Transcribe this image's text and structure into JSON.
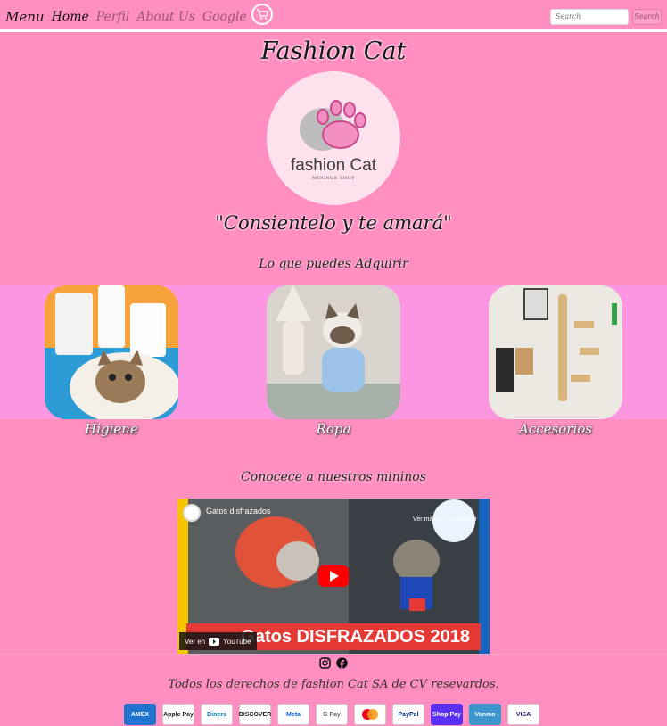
{
  "nav": {
    "brand": "Menu",
    "links": [
      {
        "label": "Home",
        "state": "active"
      },
      {
        "label": "Perfil",
        "state": "muted"
      },
      {
        "label": "About Us",
        "state": "muted"
      },
      {
        "label": "Google",
        "state": "muted"
      }
    ],
    "cart_icon": "shopping-cart-icon",
    "search": {
      "placeholder": "Search",
      "button_label": "Search"
    }
  },
  "hero": {
    "title": "Fashion Cat",
    "logo": {
      "text": "fashion Cat",
      "sub": "MININOS SHOP"
    },
    "tagline": "\"Consientelo y te amará\""
  },
  "products": {
    "heading": "Lo que puedes Adquirir",
    "items": [
      {
        "label": "Higiene"
      },
      {
        "label": "Ropa"
      },
      {
        "label": "Accesorios"
      }
    ]
  },
  "video_section": {
    "heading": "Conocece a nuestros mininos",
    "video": {
      "title": "Gatos disfrazados",
      "share_text": "Ver más ta... Compartir",
      "banner": "Gatos DISFRAZADOS 2018",
      "watch_on": "Ver en",
      "platform": "YouTube"
    }
  },
  "footer": {
    "social_icons": [
      "instagram-icon",
      "facebook-icon"
    ],
    "copyright": "Todos los derechos de fashion Cat SA de CV resevardos.",
    "payments": [
      "AMEX",
      "Apple Pay",
      "Diners",
      "DISCOVER",
      "Meta",
      "G Pay",
      "Mastercard",
      "PayPal",
      "Shop Pay",
      "Venmo",
      "VISA"
    ]
  },
  "colors": {
    "page_bg": "#ff8fc1",
    "band_bg": "#fd96e0",
    "logo_bg": "#fde2ee",
    "youtube_red": "#e53935"
  }
}
